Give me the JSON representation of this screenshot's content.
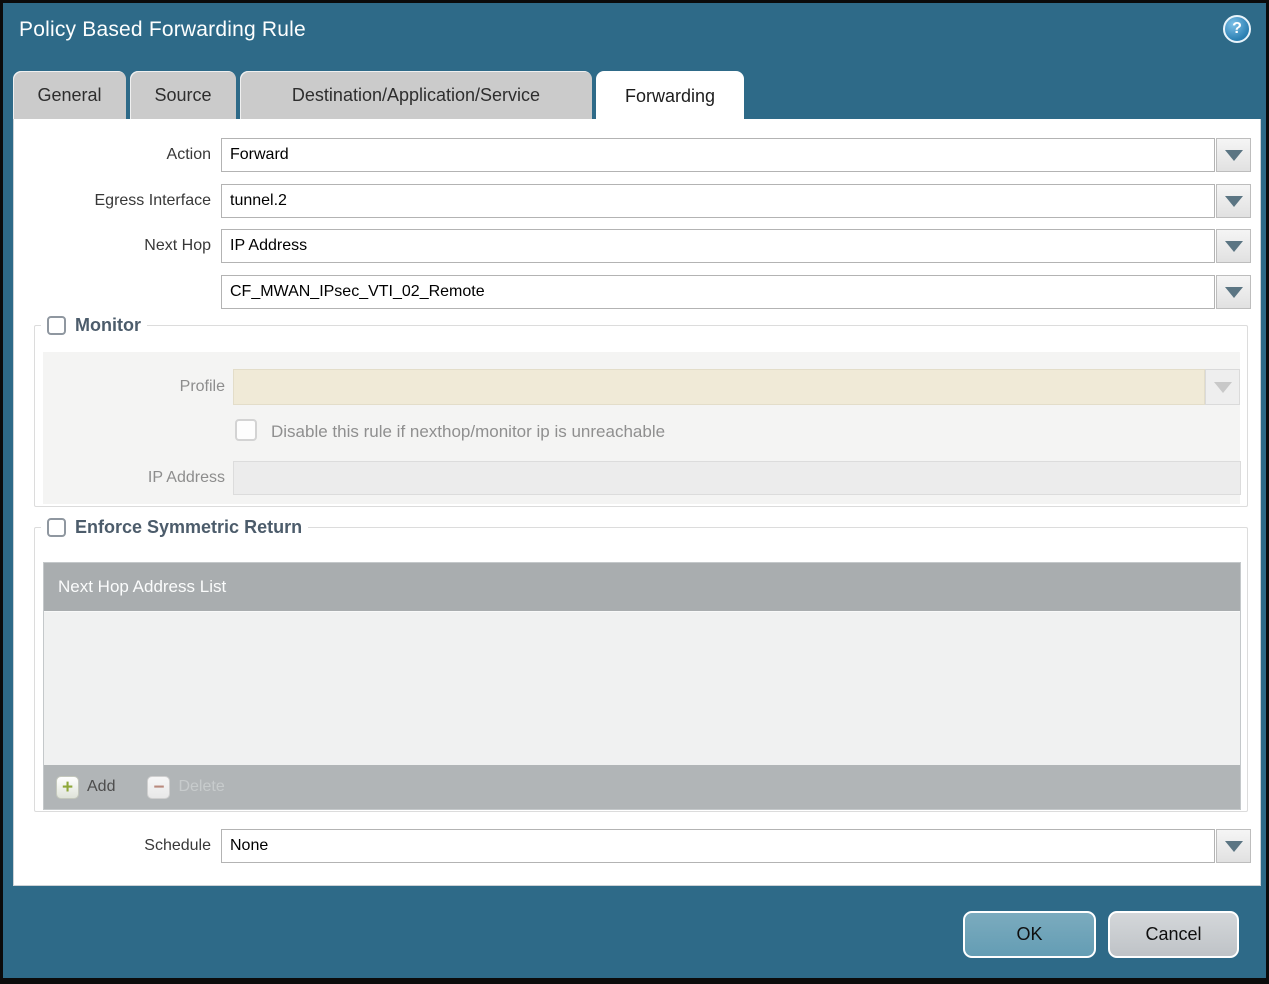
{
  "dialog": {
    "title": "Policy Based Forwarding Rule",
    "help_glyph": "?"
  },
  "tabs": [
    {
      "label": "General",
      "active": false
    },
    {
      "label": "Source",
      "active": false
    },
    {
      "label": "Destination/Application/Service",
      "active": false
    },
    {
      "label": "Forwarding",
      "active": true
    }
  ],
  "form": {
    "action": {
      "label": "Action",
      "value": "Forward"
    },
    "egress_interface": {
      "label": "Egress Interface",
      "value": "tunnel.2"
    },
    "next_hop": {
      "label": "Next Hop",
      "value": "IP Address"
    },
    "next_hop_address": {
      "value": "CF_MWAN_IPsec_VTI_02_Remote"
    },
    "schedule": {
      "label": "Schedule",
      "value": "None"
    }
  },
  "monitor": {
    "legend": "Monitor",
    "checked": false,
    "profile": {
      "label": "Profile",
      "value": ""
    },
    "disable_rule": {
      "label": "Disable this rule if nexthop/monitor ip is unreachable",
      "checked": false
    },
    "ip_address": {
      "label": "IP Address",
      "value": ""
    }
  },
  "symmetric_return": {
    "legend": "Enforce Symmetric Return",
    "checked": false,
    "table": {
      "header": "Next Hop Address List",
      "rows": []
    },
    "add_label": "Add",
    "delete_label": "Delete"
  },
  "footer": {
    "ok_label": "OK",
    "cancel_label": "Cancel"
  },
  "colors": {
    "frame_teal": "#2e6a88",
    "tab_inactive": "#cbcbcb",
    "disabled_field_beige": "#f0ead7",
    "table_header_gray": "#a9adaf",
    "ok_button_blue": "#6fa2b7",
    "dropdown_arrow": "#5b7583"
  }
}
